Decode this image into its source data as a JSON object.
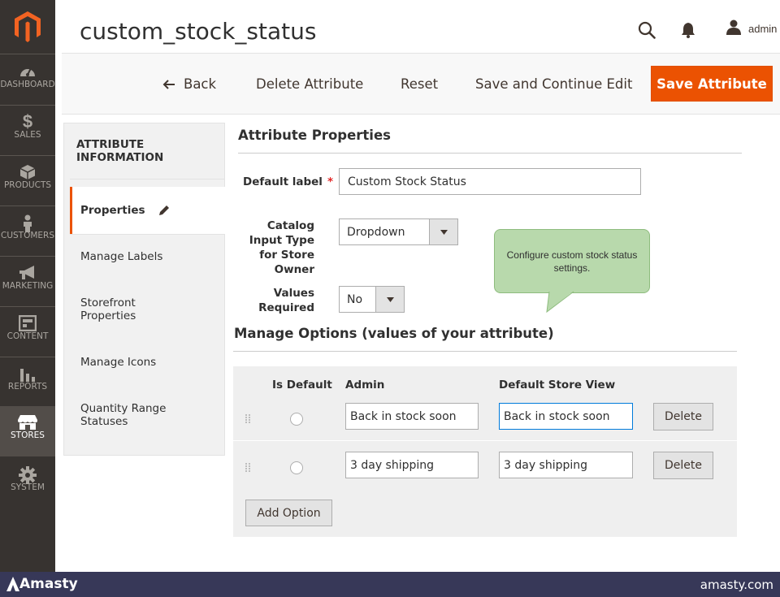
{
  "sidebar": {
    "logo": "magento-logo",
    "items": [
      {
        "label": "DASHBOARD",
        "icon": "dashboard-icon"
      },
      {
        "label": "SALES",
        "icon": "dollar-icon"
      },
      {
        "label": "PRODUCTS",
        "icon": "cube-icon"
      },
      {
        "label": "CUSTOMERS",
        "icon": "person-icon"
      },
      {
        "label": "MARKETING",
        "icon": "megaphone-icon"
      },
      {
        "label": "CONTENT",
        "icon": "layout-icon"
      },
      {
        "label": "REPORTS",
        "icon": "bar-chart-icon"
      },
      {
        "label": "STORES",
        "icon": "store-icon"
      },
      {
        "label": "SYSTEM",
        "icon": "gear-icon"
      }
    ]
  },
  "header": {
    "title": "custom_stock_status",
    "user": "admin"
  },
  "actions": {
    "back": "Back",
    "delete": "Delete Attribute",
    "reset": "Reset",
    "save_continue": "Save and Continue Edit",
    "save": "Save Attribute"
  },
  "tabs": {
    "title": "ATTRIBUTE INFORMATION",
    "items": [
      {
        "label": "Properties"
      },
      {
        "label": "Manage Labels"
      },
      {
        "label": "Storefront Properties"
      },
      {
        "label": "Manage Icons"
      },
      {
        "label": "Quantity Range Statuses"
      }
    ]
  },
  "form": {
    "section_title": "Attribute Properties",
    "default_label": {
      "label": "Default label",
      "value": "Custom Stock Status",
      "required_mark": "*"
    },
    "input_type": {
      "label": "Catalog Input Type for Store Owner",
      "value": "Dropdown"
    },
    "values_required": {
      "label": "Values Required",
      "value": "No"
    }
  },
  "callout": "Configure custom stock status settings.",
  "options": {
    "section_title": "Manage Options (values of your attribute)",
    "columns": {
      "is_default": "Is Default",
      "admin": "Admin",
      "store_view": "Default Store View"
    },
    "rows": [
      {
        "admin": "Back in stock soon",
        "store_view": "Back in stock soon",
        "delete": "Delete"
      },
      {
        "admin": "3 day shipping",
        "store_view": "3 day shipping",
        "delete": "Delete"
      }
    ],
    "add_option": "Add Option"
  },
  "footer": {
    "brand": "Amasty",
    "site": "amasty.com"
  },
  "colors": {
    "accent": "#eb5202",
    "nav_bg": "#373330",
    "callout_bg": "#b8d9ac",
    "footer_bg": "#373858"
  }
}
